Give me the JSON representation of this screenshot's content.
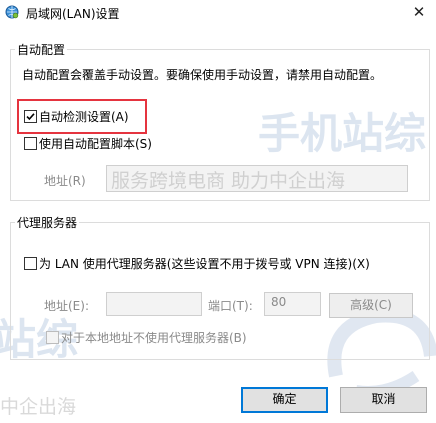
{
  "window": {
    "title": "局域网(LAN)设置",
    "close_glyph": "✕"
  },
  "auto_config": {
    "group_title": "自动配置",
    "description": "自动配置会覆盖手动设置。要确保使用手动设置，请禁用自动配置。",
    "auto_detect": {
      "label": "自动检测设置(A)",
      "checked": true
    },
    "use_script": {
      "label": "使用自动配置脚本(S)",
      "checked": false
    },
    "address_label": "地址(R)"
  },
  "proxy": {
    "group_title": "代理服务器",
    "use_proxy": {
      "label": "为 LAN 使用代理服务器(这些设置不用于拨号或 VPN 连接)(X)",
      "checked": false
    },
    "address_label": "地址(E):",
    "address_value": "",
    "port_label": "端口(T):",
    "port_value": "80",
    "advanced_label": "高级(C)",
    "bypass_local": {
      "label": "对于本地地址不使用代理服务器(B)",
      "checked": false
    }
  },
  "footer": {
    "ok_label": "确定",
    "cancel_label": "取消"
  },
  "watermarks": {
    "text_main": "服务跨境电商 助力中企出海",
    "text_left": "中企出海",
    "brand_top": "手机站综",
    "brand_left": "站综"
  },
  "colors": {
    "accent": "#0078d7",
    "highlight": "#e5343f"
  }
}
